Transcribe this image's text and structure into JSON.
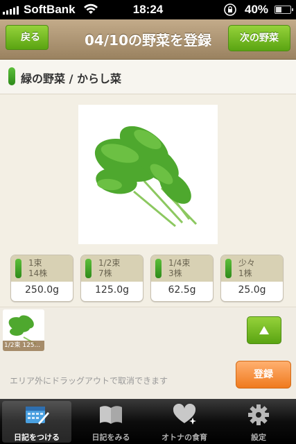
{
  "status_bar": {
    "carrier": "SoftBank",
    "time": "18:24",
    "battery": "40%"
  },
  "nav": {
    "back_label": "戻る",
    "title": "04/10の野菜を登録",
    "next_label": "次の野菜"
  },
  "heading": "緑の野菜 / からし菜",
  "amounts": [
    {
      "line1": "1束",
      "line2": "14株",
      "weight": "250.0g"
    },
    {
      "line1": "1/2束",
      "line2": "7株",
      "weight": "125.0g"
    },
    {
      "line1": "1/4束",
      "line2": "3株",
      "weight": "62.5g"
    },
    {
      "line1": "少々",
      "line2": "1株",
      "weight": "25.0g"
    }
  ],
  "selected": {
    "caption": "1/2束 125..."
  },
  "hint": "エリア外にドラッグアウトで取消できます",
  "register_label": "登録",
  "tabs": [
    {
      "label": "日記をつける",
      "icon": "calendar-pencil-icon",
      "active": true
    },
    {
      "label": "日記をみる",
      "icon": "book-icon",
      "active": false
    },
    {
      "label": "オトナの食育",
      "icon": "heart-icon",
      "active": false
    },
    {
      "label": "設定",
      "icon": "gear-icon",
      "active": false
    }
  ],
  "colors": {
    "accent_green": "#5aa412",
    "register_orange": "#ef7a1e",
    "navbar": "#b09a78"
  }
}
